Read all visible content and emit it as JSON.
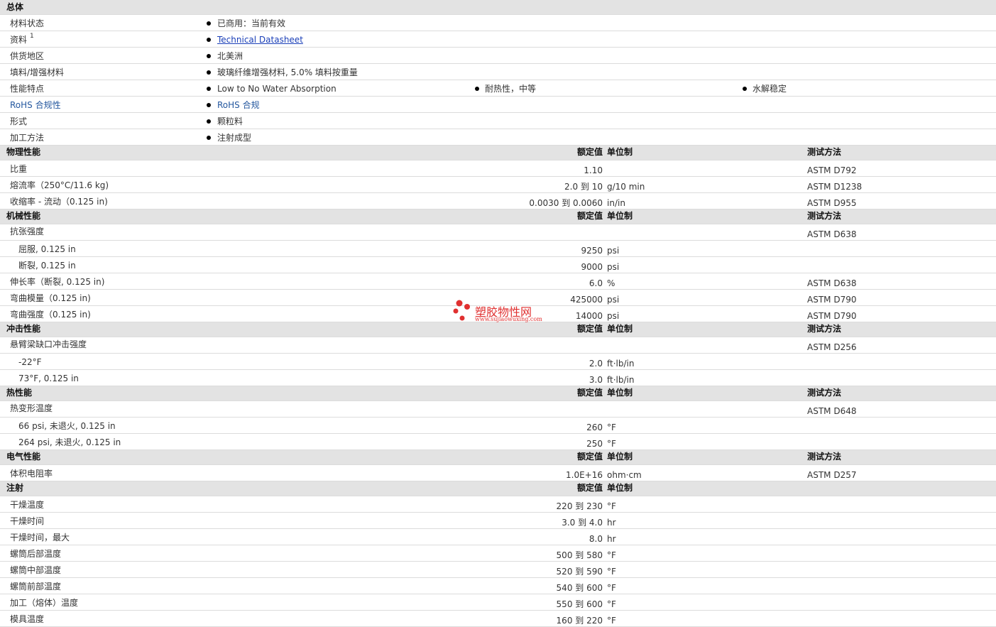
{
  "general": {
    "heading": "总体",
    "rows": [
      {
        "label": "材料状态",
        "values": [
          "已商用：当前有效"
        ]
      },
      {
        "label": "资料",
        "sup": "1",
        "values": [
          "Technical Datasheet"
        ],
        "link": true
      },
      {
        "label": "供货地区",
        "values": [
          "北美洲"
        ]
      },
      {
        "label": "填料/增强材料",
        "values": [
          "玻璃纤维增强材料, 5.0% 填料按重量"
        ]
      },
      {
        "label": "性能特点",
        "values": [
          "Low to No Water Absorption",
          "耐热性，中等",
          "水解稳定"
        ]
      },
      {
        "label": "RoHS 合规性",
        "values": [
          "RoHS 合规"
        ],
        "blue": true
      },
      {
        "label": "形式",
        "values": [
          "颗粒料"
        ]
      },
      {
        "label": "加工方法",
        "values": [
          "注射成型"
        ]
      }
    ]
  },
  "columns": {
    "nominal": "额定值",
    "unit": "单位制",
    "method": "测试方法"
  },
  "sections": [
    {
      "heading": "物理性能",
      "has_method": true,
      "rows": [
        {
          "label": "比重",
          "value": "1.10",
          "unit": "",
          "method": "ASTM D792"
        },
        {
          "label": "熔流率（250°C/11.6 kg)",
          "value": "2.0 到  10",
          "unit": "g/10 min",
          "method": "ASTM D1238"
        },
        {
          "label": "收缩率 - 流动（0.125 in)",
          "value": "0.0030 到  0.0060",
          "unit": "in/in",
          "method": "ASTM D955"
        }
      ]
    },
    {
      "heading": "机械性能",
      "has_method": true,
      "rows": [
        {
          "label": "抗张强度",
          "value": "",
          "unit": "",
          "method": "ASTM D638"
        },
        {
          "label": "屈服, 0.125 in",
          "indent": true,
          "value": "9250",
          "unit": "psi",
          "method": ""
        },
        {
          "label": "断裂, 0.125 in",
          "indent": true,
          "value": "9000",
          "unit": "psi",
          "method": ""
        },
        {
          "label": "伸长率（断裂, 0.125 in)",
          "value": "6.0",
          "unit": "%",
          "method": "ASTM D638"
        },
        {
          "label": "弯曲模量（0.125 in)",
          "value": "425000",
          "unit": "psi",
          "method": "ASTM D790"
        },
        {
          "label": "弯曲强度（0.125 in)",
          "value": "14000",
          "unit": "psi",
          "method": "ASTM D790"
        }
      ]
    },
    {
      "heading": "冲击性能",
      "has_method": true,
      "rows": [
        {
          "label": "悬臂梁缺口冲击强度",
          "value": "",
          "unit": "",
          "method": "ASTM D256"
        },
        {
          "label": "-22°F",
          "indent": true,
          "value": "2.0",
          "unit": "ft·lb/in",
          "method": ""
        },
        {
          "label": "73°F, 0.125 in",
          "indent": true,
          "value": "3.0",
          "unit": "ft·lb/in",
          "method": ""
        }
      ]
    },
    {
      "heading": "热性能",
      "has_method": true,
      "rows": [
        {
          "label": "热变形温度",
          "value": "",
          "unit": "",
          "method": "ASTM D648"
        },
        {
          "label": "66 psi, 未退火, 0.125 in",
          "indent": true,
          "value": "260",
          "unit": "°F",
          "method": ""
        },
        {
          "label": "264 psi, 未退火, 0.125 in",
          "indent": true,
          "value": "250",
          "unit": "°F",
          "method": ""
        }
      ]
    },
    {
      "heading": "电气性能",
      "has_method": true,
      "rows": [
        {
          "label": "体积电阻率",
          "value": "1.0E+16",
          "unit": "ohm·cm",
          "method": "ASTM D257"
        }
      ]
    },
    {
      "heading": "注射",
      "has_method": false,
      "rows": [
        {
          "label": "干燥温度",
          "value": "220 到  230",
          "unit": "°F",
          "method": ""
        },
        {
          "label": "干燥时间",
          "value": "3.0 到  4.0",
          "unit": "hr",
          "method": ""
        },
        {
          "label": "干燥时间，最大",
          "value": "8.0",
          "unit": "hr",
          "method": ""
        },
        {
          "label": "螺筒后部温度",
          "value": "500 到  580",
          "unit": "°F",
          "method": ""
        },
        {
          "label": "螺筒中部温度",
          "value": "520 到  590",
          "unit": "°F",
          "method": ""
        },
        {
          "label": "螺筒前部温度",
          "value": "540 到  600",
          "unit": "°F",
          "method": ""
        },
        {
          "label": "加工（熔体）温度",
          "value": "550 到  600",
          "unit": "°F",
          "method": ""
        },
        {
          "label": "模具温度",
          "value": "160 到  220",
          "unit": "°F",
          "method": ""
        }
      ]
    }
  ],
  "watermark": {
    "name": "塑胶物性网",
    "url": "www.sujiaowuxing.com",
    "color": "#e03030"
  }
}
